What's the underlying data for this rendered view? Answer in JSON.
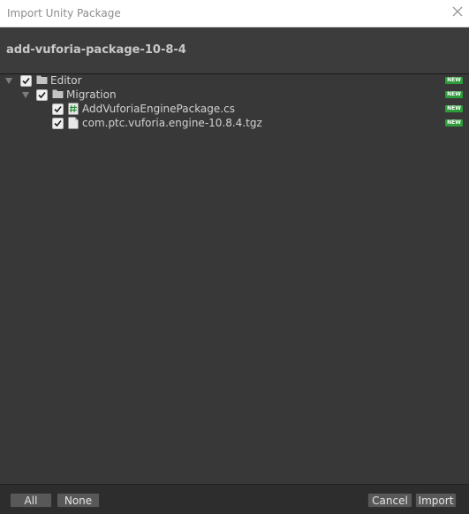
{
  "window": {
    "title": "Import Unity Package"
  },
  "header": {
    "package_name": "add-vuforia-package-10-8-4"
  },
  "tree": {
    "badge_text": "NEW",
    "items": [
      {
        "label": "Editor",
        "type": "folder",
        "checked": true,
        "expanded": true,
        "is_new": true
      },
      {
        "label": "Migration",
        "type": "folder",
        "checked": true,
        "expanded": true,
        "is_new": true
      },
      {
        "label": "AddVuforiaEnginePackage.cs",
        "type": "csharp-script",
        "checked": true,
        "is_new": true
      },
      {
        "label": "com.ptc.vuforia.engine-10.8.4.tgz",
        "type": "file",
        "checked": true,
        "is_new": true
      }
    ]
  },
  "footer": {
    "all_label": "All",
    "none_label": "None",
    "cancel_label": "Cancel",
    "import_label": "Import"
  },
  "colors": {
    "badge_green": "#2e9c3b",
    "background": "#383838",
    "footer": "#2d2d2d"
  }
}
